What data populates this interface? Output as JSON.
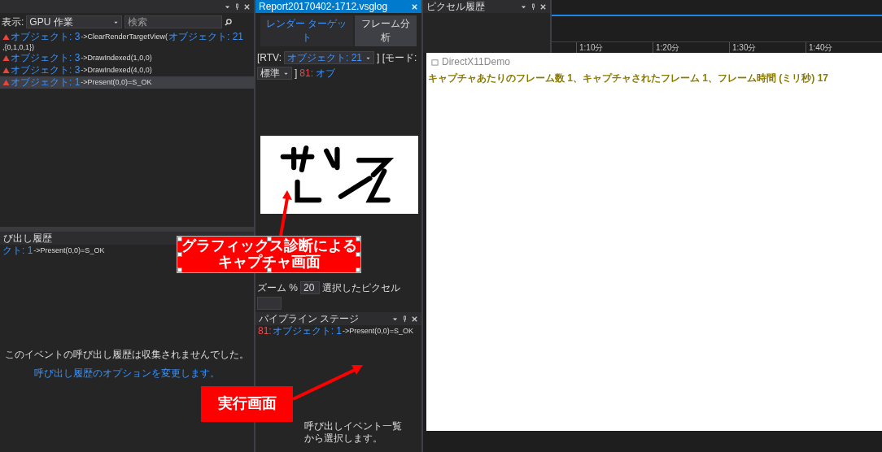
{
  "events_panel": {
    "filter_label": "表示:",
    "filter_value": "GPU 作業",
    "search": {
      "placeholder": "検索"
    },
    "rows": [
      {
        "object": "オブジェクト: 3",
        "call": "->ClearRenderTargetView(",
        "arg": "オブジェクト: 21",
        "tail": ",{0,1,0,1})",
        "selected": false
      },
      {
        "object": "オブジェクト: 3",
        "call": "->DrawIndexed(1,0,0)",
        "selected": false
      },
      {
        "object": "オブジェクト: 3",
        "call": "->DrawIndexed(4,0,0)",
        "selected": false
      },
      {
        "object": "オブジェクト: 1",
        "call": "->Present(0,0)=S_OK",
        "selected": true
      }
    ]
  },
  "call_stack_panel": {
    "title": "び出し履歴",
    "row": {
      "object": "クト: 1",
      "call": "->Present(0,0)=S_OK"
    },
    "message": "このイベントの呼び出し履歴は収集されませんでした。",
    "link": "呼び出し履歴のオプションを変更します。"
  },
  "document": {
    "tab": "Report20170402-1712.vsglog",
    "subtabs": [
      {
        "label": "レンダー ターゲット",
        "selected": true
      },
      {
        "label": "フレーム分析",
        "selected": false
      }
    ],
    "toolbar": {
      "rtv_label": "[RTV:",
      "rtv_value": "オブジェクト: 21",
      "mode_label": "] [モード:",
      "mode_value": "標準",
      "close": "]",
      "event_number": "81:",
      "event_object": "オブ"
    },
    "zoom_label": "ズーム %",
    "zoom_value": "20",
    "pixel_label": "選択したピクセル"
  },
  "pipeline_panel": {
    "title": "パイプライン ステージ",
    "row": {
      "number": "81:",
      "object": "オブジェクト: 1",
      "call": "->Present(0,0)=S_OK"
    },
    "hint_lines": [
      "呼び出しイベント一覧",
      "から選択します。"
    ]
  },
  "pixel_history_panel": {
    "title": "ピクセル履歴"
  },
  "timeline": {
    "ticks": [
      "1:10分",
      "1:20分",
      "1:30分",
      "1:40分"
    ]
  },
  "app_window": {
    "title": "DirectX11Demo",
    "status": "キャプチャあたりのフレーム数 1、キャプチャされたフレーム 1、フレーム時間 (ミリ秒) 17"
  },
  "callouts": [
    {
      "kind": "capture",
      "lines": [
        "グラフィックス診断による",
        "キャプチャ画面"
      ]
    },
    {
      "kind": "running",
      "lines": [
        "実行画面"
      ]
    }
  ]
}
